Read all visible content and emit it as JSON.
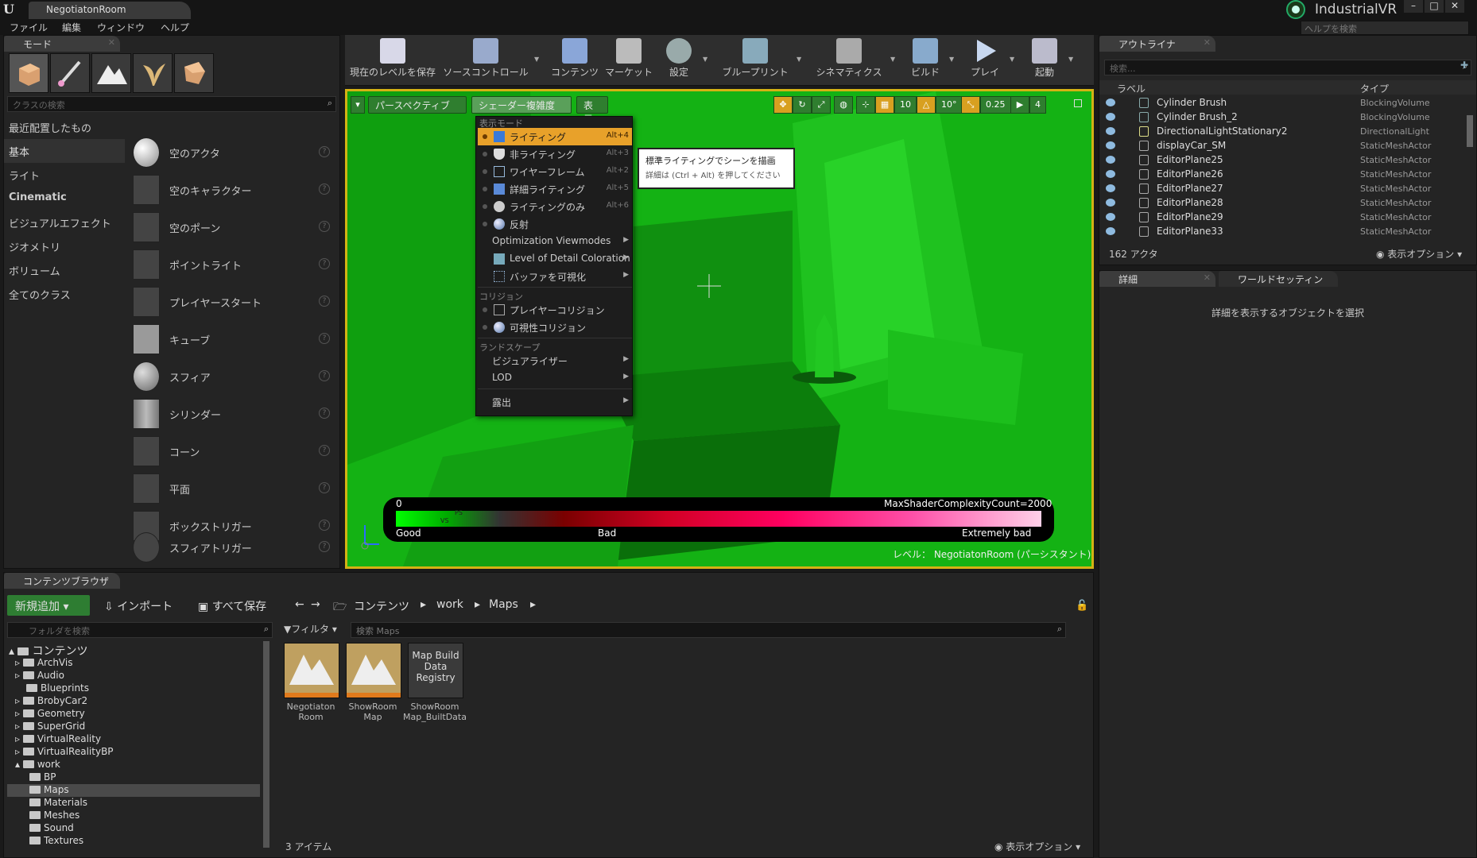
{
  "titlebar": {
    "doc_tab": "NegotiatonRoom",
    "project": "IndustrialVR",
    "help_search_placeholder": "ヘルプを検索"
  },
  "menubar": [
    "ファイル",
    "編集",
    "ウィンドウ",
    "ヘルプ"
  ],
  "modes": {
    "tab": "モード",
    "search_placeholder": "クラスの検索",
    "categories": [
      "最近配置したもの",
      "基本",
      "ライト",
      "Cinematic",
      "ビジュアルエフェクト",
      "ジオメトリ",
      "ボリューム",
      "全てのクラス"
    ],
    "active_category": "基本",
    "items": [
      "空のアクタ",
      "空のキャラクター",
      "空のポーン",
      "ポイントライト",
      "プレイヤースタート",
      "キューブ",
      "スフィア",
      "シリンダー",
      "コーン",
      "平面",
      "ボックストリガー",
      "スフィアトリガー"
    ],
    "help": "?"
  },
  "toolbar": {
    "save": "現在のレベルを保存",
    "source": "ソースコントロール",
    "content": "コンテンツ",
    "market": "マーケット",
    "settings": "設定",
    "blueprints": "ブループリント",
    "cinematics": "シネマティクス",
    "build": "ビルド",
    "play": "プレイ",
    "launch": "起動"
  },
  "viewport": {
    "perspective": "パースペクティブ",
    "shader_complexity": "シェーダー複雑度",
    "show": "表示",
    "grid_snap": "10",
    "rot_snap": "10°",
    "scale_snap": "0.25",
    "cam_speed": "4",
    "level_label": "レベル： NegotiatonRoom (パーシスタント)"
  },
  "view_menu": {
    "section_view": "表示モード",
    "items": [
      {
        "label": "ライティング",
        "shortcut": "Alt+4"
      },
      {
        "label": "非ライティング",
        "shortcut": "Alt+3"
      },
      {
        "label": "ワイヤーフレーム",
        "shortcut": "Alt+2"
      },
      {
        "label": "詳細ライティング",
        "shortcut": "Alt+5"
      },
      {
        "label": "ライティングのみ",
        "shortcut": "Alt+6"
      },
      {
        "label": "反射",
        "shortcut": ""
      }
    ],
    "optimization": "Optimization Viewmodes",
    "lod_coloration": "Level of Detail Coloration",
    "buffer": "バッファを可視化",
    "section_collision": "コリジョン",
    "player_collision": "プレイヤーコリジョン",
    "visibility_collision": "可視性コリジョン",
    "section_landscape": "ランドスケープ",
    "visualizer": "ビジュアライザー",
    "lod": "LOD",
    "exposure": "露出"
  },
  "tooltip": {
    "title": "標準ライティングでシーンを描画",
    "detail": "詳細は (Ctrl + Alt) を押してください"
  },
  "complexity_bar": {
    "zero": "0",
    "max": "MaxShaderComplexityCount=2000",
    "good": "Good",
    "bad": "Bad",
    "extremely_bad": "Extremely bad",
    "ps": "PS",
    "vs": "VS"
  },
  "outliner": {
    "tab": "アウトライナ",
    "search_placeholder": "検索...",
    "col_label": "ラベル",
    "col_type": "タイプ",
    "rows": [
      {
        "label": "Cylinder Brush",
        "type": "BlockingVolume"
      },
      {
        "label": "Cylinder Brush_2",
        "type": "BlockingVolume"
      },
      {
        "label": "DirectionalLightStationary2",
        "type": "DirectionalLight"
      },
      {
        "label": "displayCar_SM",
        "type": "StaticMeshActor"
      },
      {
        "label": "EditorPlane25",
        "type": "StaticMeshActor"
      },
      {
        "label": "EditorPlane26",
        "type": "StaticMeshActor"
      },
      {
        "label": "EditorPlane27",
        "type": "StaticMeshActor"
      },
      {
        "label": "EditorPlane28",
        "type": "StaticMeshActor"
      },
      {
        "label": "EditorPlane29",
        "type": "StaticMeshActor"
      },
      {
        "label": "EditorPlane33",
        "type": "StaticMeshActor"
      }
    ],
    "count": "162 アクタ",
    "view_options": "表示オプション"
  },
  "details": {
    "tab": "詳細",
    "world_tab": "ワールドセッティン",
    "empty_text": "詳細を表示するオブジェクトを選択"
  },
  "content_browser": {
    "tab": "コンテンツブラウザ",
    "add_new": "新規追加",
    "import": "インポート",
    "save_all": "すべて保存",
    "path": [
      "コンテンツ",
      "work",
      "Maps"
    ],
    "folder_search_placeholder": "フォルダを検索",
    "filter": "フィルタ",
    "asset_search_placeholder": "検索 Maps",
    "tree": [
      {
        "label": "コンテンツ",
        "level": 0
      },
      {
        "label": "ArchVis",
        "level": 1
      },
      {
        "label": "Audio",
        "level": 1
      },
      {
        "label": "Blueprints",
        "level": 1
      },
      {
        "label": "BrobyCar2",
        "level": 1
      },
      {
        "label": "Geometry",
        "level": 1
      },
      {
        "label": "SuperGrid",
        "level": 1
      },
      {
        "label": "VirtualReality",
        "level": 1
      },
      {
        "label": "VirtualRealityBP",
        "level": 1
      },
      {
        "label": "work",
        "level": 1
      },
      {
        "label": "BP",
        "level": 2
      },
      {
        "label": "Maps",
        "level": 2
      },
      {
        "label": "Materials",
        "level": 2
      },
      {
        "label": "Meshes",
        "level": 2
      },
      {
        "label": "Sound",
        "level": 2
      },
      {
        "label": "Textures",
        "level": 2
      }
    ],
    "assets": [
      {
        "label1": "Negotiaton",
        "label2": "Room",
        "thumb": ""
      },
      {
        "label1": "ShowRoom",
        "label2": "Map",
        "thumb": ""
      },
      {
        "label1": "ShowRoom",
        "label2": "Map_BuiltData",
        "thumb": "Map Build Data Registry"
      }
    ],
    "item_count": "3 アイテム",
    "view_options": "表示オプション"
  }
}
